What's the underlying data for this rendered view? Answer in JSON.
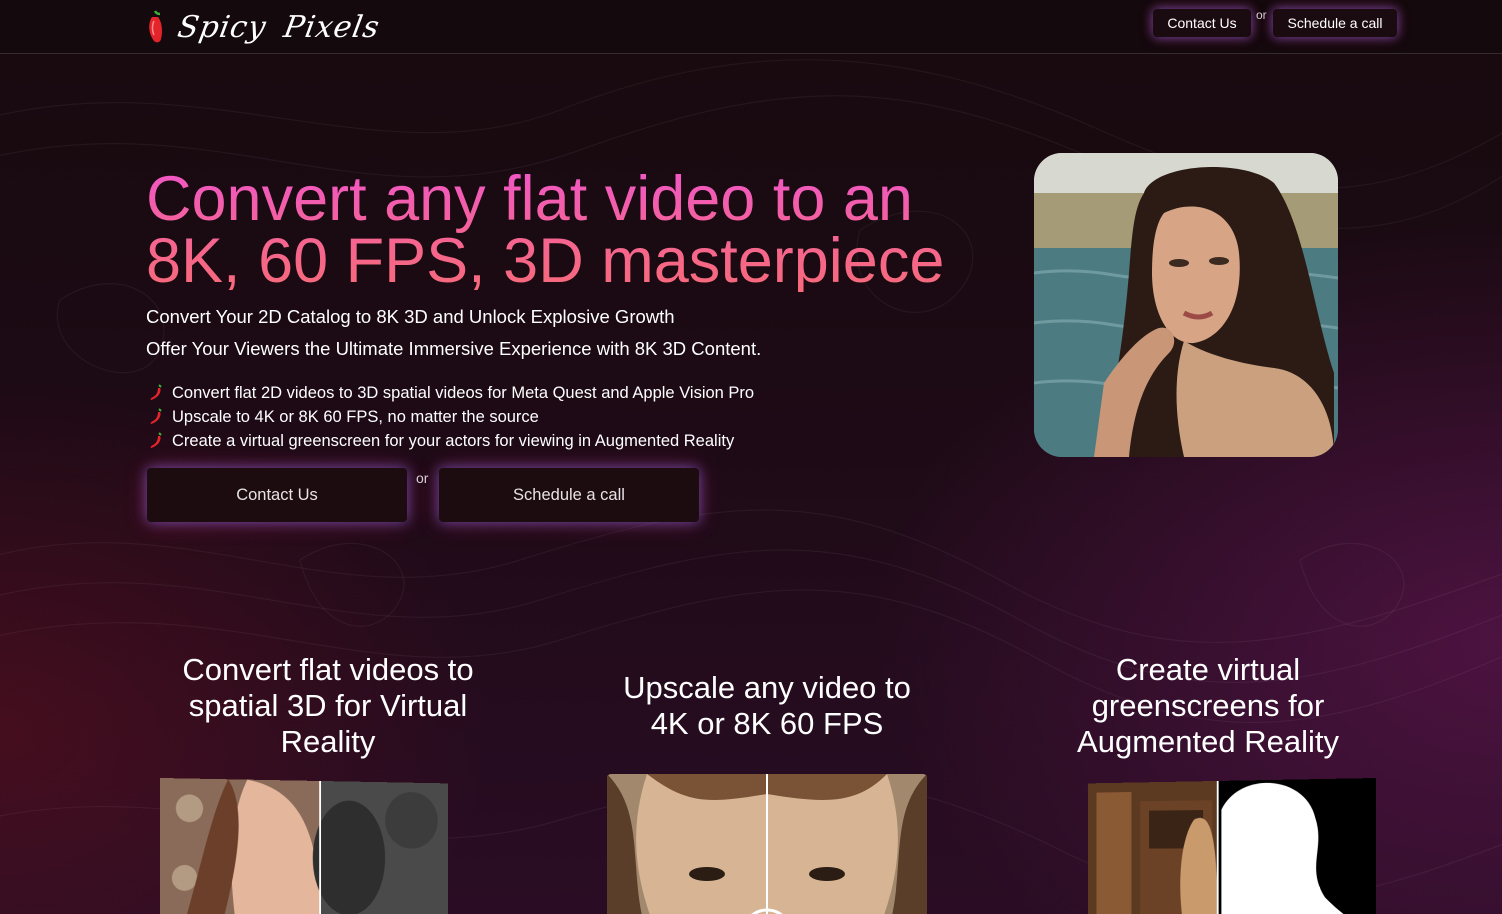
{
  "header": {
    "logo_text_1": "Spicy",
    "logo_text_2": "Pixels",
    "contact_label": "Contact Us",
    "or_label": "or",
    "schedule_label": "Schedule a call"
  },
  "hero": {
    "title_line_1": "Convert any flat video to an",
    "title_line_2": "8K, 60 FPS, 3D masterpiece",
    "subtitle_1": "Convert Your 2D Catalog to 8K 3D and Unlock Explosive Growth",
    "subtitle_2": "Offer Your Viewers the Ultimate Immersive Experience with 8K 3D Content.",
    "bullets": [
      "Convert flat 2D videos to 3D spatial videos for Meta Quest and Apple Vision Pro",
      "Upscale to 4K or 8K 60 FPS, no matter the source",
      "Create a virtual greenscreen for your actors for viewing in Augmented Reality"
    ],
    "contact_label": "Contact Us",
    "or_label": "or",
    "schedule_label": "Schedule a call"
  },
  "features": [
    {
      "title_lines": [
        "Convert flat videos to",
        "spatial 3D for Virtual",
        "Reality"
      ]
    },
    {
      "title_lines": [
        "Upscale any video to",
        "4K or 8K 60 FPS"
      ]
    },
    {
      "title_lines": [
        "Create virtual",
        "greenscreens for",
        "Augmented Reality"
      ]
    }
  ],
  "colors": {
    "accent_pink": "#f056c8",
    "accent_coral": "#f76a7a",
    "button_bg": "#1c0c0f",
    "glow_blue": "#8c6eff"
  },
  "icons": {
    "bullet_icon": "chili-pepper-icon",
    "logo_icon": "chili-pepper-icon"
  }
}
